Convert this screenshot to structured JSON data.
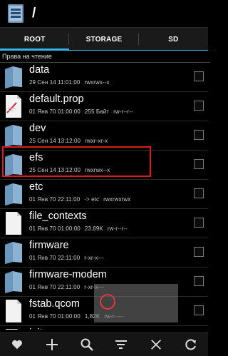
{
  "header": {
    "path": "/"
  },
  "tabs": [
    {
      "label": "ROOT",
      "active": true
    },
    {
      "label": "STORAGE",
      "active": false
    },
    {
      "label": "SD",
      "active": false
    }
  ],
  "permissions_label": "Права на чтение",
  "files": [
    {
      "name": "data",
      "date": "29 Сен 14 11:01:00",
      "size": "",
      "perms": "rwxrwx--x",
      "type": "folder"
    },
    {
      "name": "default.prop",
      "date": "01 Янв 70 01:00:00",
      "size": "255 Байт",
      "perms": "rw-r--r--",
      "type": "file-edited"
    },
    {
      "name": "dev",
      "date": "25 Сен 14 13:12:00",
      "size": "",
      "perms": "rwxr-xr-x",
      "type": "folder"
    },
    {
      "name": "efs",
      "date": "25 Сен 14 13:12:00",
      "size": "",
      "perms": "rwxrwx--x",
      "type": "folder"
    },
    {
      "name": "etc",
      "date": "01 Янв 70 22:11:00",
      "size": "-> etc",
      "perms": "rwxrwxrwx",
      "type": "folder"
    },
    {
      "name": "file_contexts",
      "date": "01 Янв 70 01:00:00",
      "size": "23,69K",
      "perms": "rw-r--r--",
      "type": "file"
    },
    {
      "name": "firmware",
      "date": "01 Янв 70 22:11:00",
      "size": "",
      "perms": "r-xr-x---",
      "type": "folder"
    },
    {
      "name": "firmware-modem",
      "date": "01 Янв 70 22:11:00",
      "size": "",
      "perms": "r-xr-x---",
      "type": "folder"
    },
    {
      "name": "fstab.qcom",
      "date": "01 Янв 70 01:00:00",
      "size": "1,82K",
      "perms": "rw-r-----",
      "type": "file"
    },
    {
      "name": "init",
      "date": "",
      "size": "",
      "perms": "",
      "type": "file"
    }
  ],
  "toolbar": [
    "heart-icon",
    "plus-icon",
    "search-icon",
    "sort-icon",
    "close-icon",
    "refresh-icon"
  ],
  "colors": {
    "accent": "#33b5e5",
    "highlight": "#e0191f",
    "folder": "#7ea8c9"
  }
}
